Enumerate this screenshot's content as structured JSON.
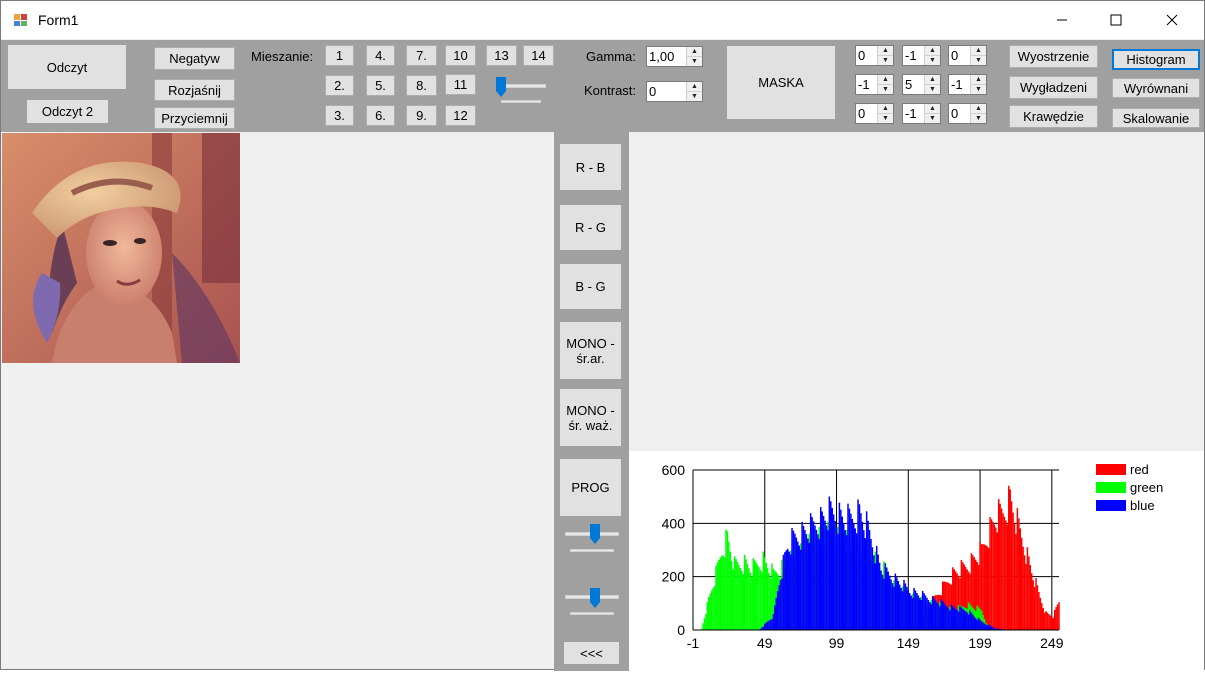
{
  "window": {
    "title": "Form1",
    "controls": {
      "minimize": "minimize-icon",
      "maximize": "maximize-icon",
      "close": "close-icon"
    }
  },
  "toolbar": {
    "read_button": "Odczyt",
    "read2_button": "Odczyt 2",
    "negative_button": "Negatyw",
    "brighten_button": "Rozjaśnij",
    "darken_button": "Przyciemnij",
    "mixing_label": "Mieszanie:",
    "mixing_buttons": [
      "1",
      "4.",
      "7.",
      "10",
      "13",
      "14",
      "2.",
      "5.",
      "8.",
      "11",
      "3.",
      "6.",
      "9.",
      "12"
    ],
    "mixing_slider_value": 0,
    "gamma_label": "Gamma:",
    "gamma_value": "1,00",
    "contrast_label": "Kontrast:",
    "contrast_value": "0",
    "mask_button": "MASKA",
    "mask_values": [
      "0",
      "-1",
      "0",
      "-1",
      "5",
      "-1",
      "0",
      "-1",
      "0"
    ],
    "sharpen_button": "Wyostrzenie",
    "smooth_button": "Wygładzeni",
    "edges_button": "Krawędzie",
    "histogram_button": "Histogram",
    "equalize_button": "Wyrównani",
    "scaling_button": "Skalowanie"
  },
  "rgb_panel": {
    "rb_button": "R - B",
    "rg_button": "R - G",
    "bg_button": "B - G",
    "mono_avg_button": "MONO - śr.ar.",
    "mono_weighted_button": "MONO - śr. waż.",
    "threshold_button": "PROG",
    "back_button": "<<<",
    "slider1_value": 0.5,
    "slider2_value": 0.5
  },
  "colors": {
    "toolbar_bg": "#a0a0a0",
    "button_bg": "#e1e1e1",
    "focus_border": "#0078d7",
    "slider_thumb": "#0078d7",
    "red": "#ff0000",
    "green": "#00ff00",
    "blue": "#0000ff"
  },
  "chart_data": {
    "type": "histogram",
    "x_tick_labels": [
      "-1",
      "49",
      "99",
      "149",
      "199",
      "249"
    ],
    "y_tick_labels": [
      "0",
      "200",
      "400",
      "600"
    ],
    "ylim": [
      0,
      600
    ],
    "xlim": [
      -1,
      254
    ],
    "grid": true,
    "legend_position": "top-right",
    "series": [
      {
        "name": "red",
        "color": "#ff0000",
        "points": [
          [
            150,
            5
          ],
          [
            160,
            60
          ],
          [
            170,
            130
          ],
          [
            180,
            200
          ],
          [
            190,
            230
          ],
          [
            200,
            280
          ],
          [
            205,
            350
          ],
          [
            210,
            400
          ],
          [
            215,
            420
          ],
          [
            220,
            470
          ],
          [
            225,
            380
          ],
          [
            230,
            300
          ],
          [
            235,
            210
          ],
          [
            240,
            130
          ],
          [
            245,
            60
          ],
          [
            250,
            50
          ],
          [
            254,
            100
          ]
        ]
      },
      {
        "name": "green",
        "color": "#00ff00",
        "points": [
          [
            5,
            5
          ],
          [
            10,
            110
          ],
          [
            15,
            200
          ],
          [
            20,
            300
          ],
          [
            23,
            330
          ],
          [
            28,
            230
          ],
          [
            35,
            240
          ],
          [
            40,
            220
          ],
          [
            48,
            250
          ],
          [
            55,
            200
          ],
          [
            70,
            260
          ],
          [
            80,
            300
          ],
          [
            90,
            340
          ],
          [
            100,
            330
          ],
          [
            110,
            300
          ],
          [
            120,
            280
          ],
          [
            130,
            230
          ],
          [
            140,
            150
          ],
          [
            150,
            120
          ],
          [
            160,
            100
          ],
          [
            170,
            90
          ],
          [
            180,
            70
          ],
          [
            190,
            90
          ],
          [
            200,
            70
          ],
          [
            205,
            5
          ]
        ]
      },
      {
        "name": "blue",
        "color": "#0000ff",
        "points": [
          [
            45,
            0
          ],
          [
            55,
            50
          ],
          [
            60,
            200
          ],
          [
            65,
            300
          ],
          [
            70,
            330
          ],
          [
            80,
            360
          ],
          [
            90,
            400
          ],
          [
            95,
            420
          ],
          [
            100,
            410
          ],
          [
            105,
            390
          ],
          [
            110,
            400
          ],
          [
            115,
            420
          ],
          [
            120,
            370
          ],
          [
            125,
            300
          ],
          [
            130,
            220
          ],
          [
            140,
            180
          ],
          [
            150,
            140
          ],
          [
            160,
            120
          ],
          [
            170,
            100
          ],
          [
            180,
            80
          ],
          [
            190,
            70
          ],
          [
            200,
            30
          ],
          [
            210,
            5
          ],
          [
            220,
            0
          ]
        ]
      }
    ]
  }
}
